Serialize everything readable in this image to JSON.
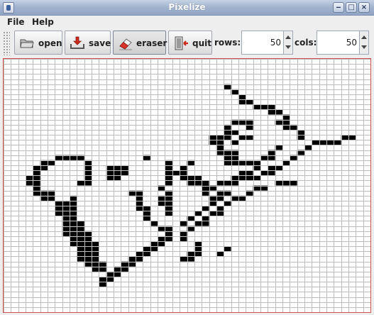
{
  "window": {
    "title": "Pixelize",
    "controls": {
      "minimize": "‒",
      "maximize": "□",
      "close": "×"
    }
  },
  "menu": [
    {
      "label": "File"
    },
    {
      "label": "Help"
    }
  ],
  "toolbar": {
    "buttons": [
      {
        "label": "open",
        "icon": "folder-icon"
      },
      {
        "label": "save",
        "icon": "save-icon"
      },
      {
        "label": "eraser",
        "icon": "eraser-icon",
        "selected": true
      },
      {
        "label": "quit",
        "icon": "exit-door-icon"
      }
    ],
    "rows": {
      "label": "rows:",
      "value": "50"
    },
    "cols": {
      "label": "cols:",
      "value": "50"
    }
  },
  "grid": {
    "rows": 50,
    "cols": 50,
    "line_color": "#bcbcbc",
    "background": "#ffffff",
    "fill_color": "#000000",
    "border_color": "#d05050",
    "filled_segments": [
      [
        5,
        30,
        30
      ],
      [
        6,
        31,
        31
      ],
      [
        7,
        32,
        32
      ],
      [
        8,
        32,
        33
      ],
      [
        9,
        34,
        36
      ],
      [
        10,
        36,
        37
      ],
      [
        11,
        38,
        38
      ],
      [
        12,
        31,
        33
      ],
      [
        12,
        37,
        38
      ],
      [
        13,
        30,
        30
      ],
      [
        13,
        33,
        33
      ],
      [
        13,
        38,
        39
      ],
      [
        14,
        30,
        31
      ],
      [
        14,
        40,
        40
      ],
      [
        15,
        28,
        30
      ],
      [
        15,
        32,
        33
      ],
      [
        15,
        40,
        40
      ],
      [
        15,
        46,
        47
      ],
      [
        16,
        28,
        29
      ],
      [
        16,
        31,
        31
      ],
      [
        16,
        42,
        45
      ],
      [
        17,
        29,
        29
      ],
      [
        17,
        37,
        37
      ],
      [
        17,
        41,
        41
      ],
      [
        18,
        29,
        31
      ],
      [
        18,
        36,
        36
      ],
      [
        18,
        40,
        40
      ],
      [
        19,
        7,
        10
      ],
      [
        19,
        19,
        19
      ],
      [
        19,
        30,
        31
      ],
      [
        19,
        35,
        36
      ],
      [
        19,
        39,
        39
      ],
      [
        20,
        5,
        6
      ],
      [
        20,
        11,
        11
      ],
      [
        20,
        22,
        22
      ],
      [
        20,
        25,
        25
      ],
      [
        20,
        30,
        34
      ],
      [
        20,
        38,
        38
      ],
      [
        21,
        4,
        5
      ],
      [
        21,
        11,
        11
      ],
      [
        21,
        14,
        16
      ],
      [
        21,
        22,
        22
      ],
      [
        21,
        24,
        24
      ],
      [
        21,
        34,
        34
      ],
      [
        21,
        36,
        37
      ],
      [
        22,
        4,
        4
      ],
      [
        22,
        11,
        11
      ],
      [
        22,
        14,
        16
      ],
      [
        22,
        22,
        24
      ],
      [
        22,
        32,
        33
      ],
      [
        22,
        35,
        36
      ],
      [
        23,
        3,
        4
      ],
      [
        23,
        11,
        11
      ],
      [
        23,
        14,
        15
      ],
      [
        23,
        22,
        22
      ],
      [
        23,
        24,
        26
      ],
      [
        23,
        31,
        34
      ],
      [
        24,
        3,
        4
      ],
      [
        24,
        10,
        11
      ],
      [
        24,
        22,
        22
      ],
      [
        24,
        25,
        27
      ],
      [
        24,
        29,
        31
      ],
      [
        24,
        37,
        39
      ],
      [
        25,
        4,
        4
      ],
      [
        25,
        21,
        21
      ],
      [
        25,
        27,
        28
      ],
      [
        25,
        34,
        35
      ],
      [
        26,
        4,
        6
      ],
      [
        26,
        17,
        18
      ],
      [
        26,
        22,
        22
      ],
      [
        26,
        27,
        27
      ],
      [
        26,
        29,
        30
      ],
      [
        26,
        33,
        33
      ],
      [
        27,
        5,
        6
      ],
      [
        27,
        9,
        9
      ],
      [
        27,
        18,
        18
      ],
      [
        27,
        21,
        22
      ],
      [
        27,
        28,
        29
      ],
      [
        27,
        31,
        32
      ],
      [
        28,
        7,
        9
      ],
      [
        28,
        18,
        18
      ],
      [
        28,
        21,
        22
      ],
      [
        28,
        28,
        28
      ],
      [
        28,
        30,
        30
      ],
      [
        29,
        7,
        9
      ],
      [
        29,
        18,
        19
      ],
      [
        29,
        22,
        22
      ],
      [
        29,
        27,
        27
      ],
      [
        29,
        29,
        29
      ],
      [
        30,
        7,
        9
      ],
      [
        30,
        19,
        19
      ],
      [
        30,
        22,
        22
      ],
      [
        30,
        26,
        26
      ],
      [
        30,
        28,
        29
      ],
      [
        31,
        8,
        9
      ],
      [
        31,
        19,
        19
      ],
      [
        31,
        25,
        25
      ],
      [
        31,
        27,
        27
      ],
      [
        32,
        8,
        10
      ],
      [
        32,
        20,
        20
      ],
      [
        32,
        24,
        24
      ],
      [
        32,
        26,
        27
      ],
      [
        33,
        8,
        10
      ],
      [
        33,
        21,
        22
      ],
      [
        33,
        25,
        25
      ],
      [
        34,
        8,
        11
      ],
      [
        34,
        22,
        22
      ],
      [
        34,
        24,
        24
      ],
      [
        35,
        9,
        11
      ],
      [
        35,
        21,
        22
      ],
      [
        35,
        24,
        24
      ],
      [
        36,
        9,
        12
      ],
      [
        36,
        20,
        21
      ],
      [
        36,
        26,
        26
      ],
      [
        37,
        10,
        12
      ],
      [
        37,
        19,
        20
      ],
      [
        37,
        26,
        26
      ],
      [
        37,
        30,
        30
      ],
      [
        38,
        10,
        12
      ],
      [
        38,
        18,
        19
      ],
      [
        38,
        25,
        26
      ],
      [
        38,
        29,
        29
      ],
      [
        39,
        10,
        12
      ],
      [
        39,
        17,
        18
      ],
      [
        39,
        24,
        25
      ],
      [
        40,
        11,
        13
      ],
      [
        40,
        16,
        17
      ],
      [
        41,
        12,
        13
      ],
      [
        41,
        15,
        16
      ],
      [
        42,
        14,
        15
      ],
      [
        43,
        13,
        14
      ],
      [
        44,
        13,
        13
      ]
    ]
  }
}
